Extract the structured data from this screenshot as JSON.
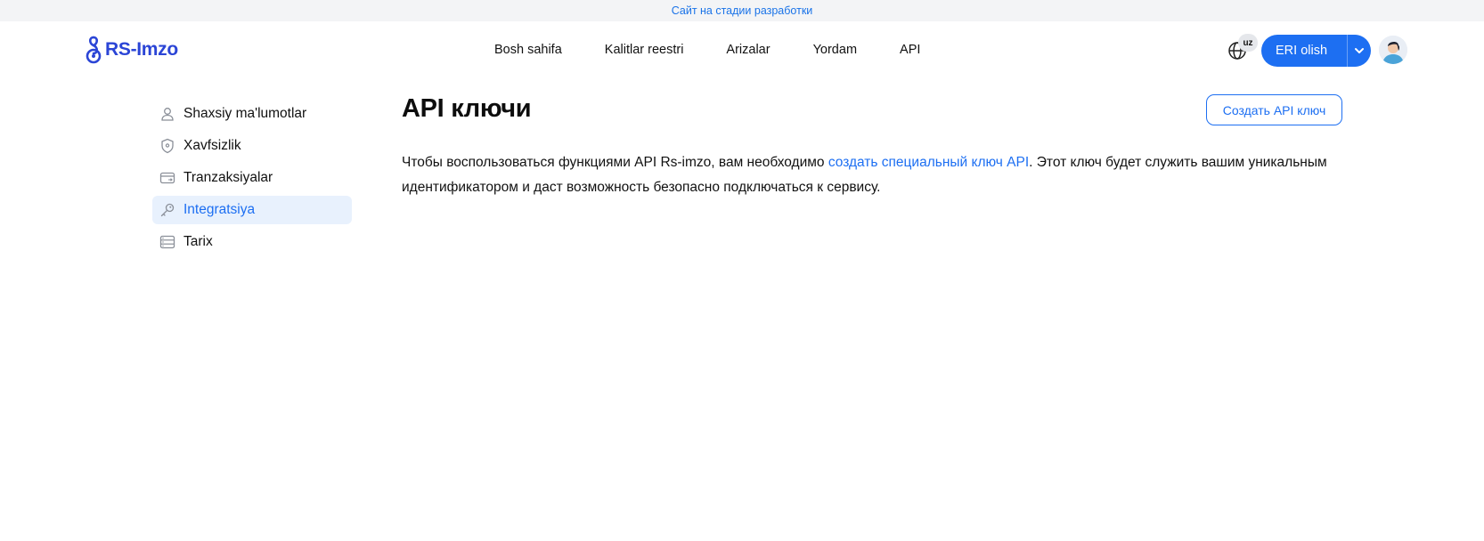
{
  "banner": {
    "text": "Сайт на стадии разработки"
  },
  "header": {
    "logo_text": "RS-Imzo",
    "nav": [
      {
        "label": "Bosh sahifa"
      },
      {
        "label": "Kalitlar reestri"
      },
      {
        "label": "Arizalar"
      },
      {
        "label": "Yordam"
      },
      {
        "label": "API"
      }
    ],
    "lang_badge": "uz",
    "eri_button_label": "ERI olish",
    "accent_color": "#1d6ff2"
  },
  "sidebar": {
    "items": [
      {
        "label": "Shaxsiy ma'lumotlar",
        "icon": "user-icon"
      },
      {
        "label": "Xavfsizlik",
        "icon": "shield-icon"
      },
      {
        "label": "Tranzaksiyalar",
        "icon": "card-transfer-icon"
      },
      {
        "label": "Integratsiya",
        "icon": "key-icon",
        "active": true
      },
      {
        "label": "Tarix",
        "icon": "list-stack-icon"
      }
    ]
  },
  "main": {
    "title": "API ключи",
    "create_button_label": "Создать API ключ",
    "description_before": "Чтобы воспользоваться функциями API Rs-imzo, вам необходимо ",
    "description_link": "создать специальный ключ API",
    "description_after": ". Этот ключ будет служить вашим уникальным идентификатором и даст возможность безопасно подключаться к сервису."
  }
}
